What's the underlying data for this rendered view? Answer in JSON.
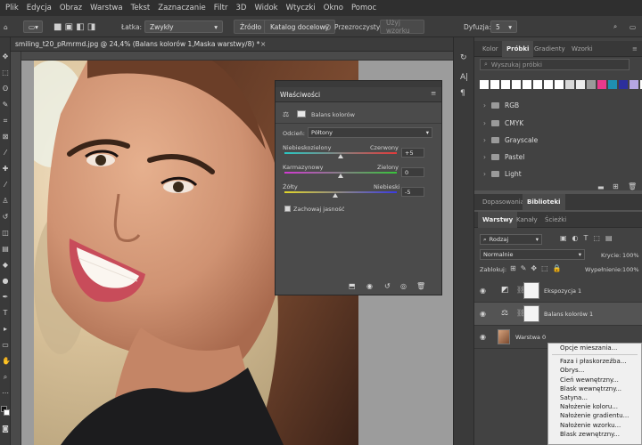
{
  "menu": [
    "Plik",
    "Edycja",
    "Obraz",
    "Warstwa",
    "Tekst",
    "Zaznaczanie",
    "Filtr",
    "3D",
    "Widok",
    "Wtyczki",
    "Okno",
    "Pomoc"
  ],
  "options": {
    "latka_label": "Łatka:",
    "latka_value": "Zwykły",
    "zrodlo": "Źródło",
    "katalog": "Katalog docelowy",
    "przezroczysty": "Przezroczysty",
    "uzyj_wzorku": "Użyj wzorku",
    "dyfuzja_label": "Dyfuzja:",
    "dyfuzja_value": "5"
  },
  "document": {
    "tab_title": "smiling_t20_pRmrmd.jpg @ 24,4% (Balans kolorów 1,Maska warstwy/8) *",
    "close": "×"
  },
  "properties": {
    "title": "Właściwości",
    "adjustment": "Balans kolorów",
    "tone_label": "Odcień:",
    "tone_value": "Półtony",
    "slider1_left": "Niebieskozielony",
    "slider1_right": "Czerwony",
    "slider1_value": "+5",
    "slider2_left": "Karmazynowy",
    "slider2_right": "Zielony",
    "slider2_value": "0",
    "slider3_left": "Żółty",
    "slider3_right": "Niebieski",
    "slider3_value": "-5",
    "preserve": "Zachowaj jasność"
  },
  "swatches_panel": {
    "tabs": [
      "Kolor",
      "Próbki",
      "Gradienty",
      "Wzorki"
    ],
    "active_tab": "Próbki",
    "search_placeholder": "Wyszukaj próbki",
    "swatch_colors": [
      "#ffffff",
      "#ffffff",
      "#ffffff",
      "#ffffff",
      "#ffffff",
      "#ffffff",
      "#ffffff",
      "#ffffff",
      "#d8d8d8",
      "#ececec",
      "#9a9a9a",
      "#e83a8c",
      "#1f8fb0",
      "#2c2f9c",
      "#b6a6e4",
      "#ffffff"
    ],
    "folders": [
      "RGB",
      "CMYK",
      "Grayscale",
      "Pastel",
      "Light"
    ]
  },
  "adjust_tabs": [
    "Dopasowania",
    "Biblioteki"
  ],
  "layers_panel": {
    "tabs": [
      "Warstwy",
      "Kanały",
      "Ścieżki"
    ],
    "filter_kind": "Rodzaj",
    "blend_mode": "Normalnie",
    "opacity_label": "Krycie:",
    "opacity_value": "100%",
    "lock_label": "Zablokuj:",
    "fill_label": "Wypełnienie:",
    "fill_value": "100%",
    "layers": [
      {
        "name": "Ekspozycja 1"
      },
      {
        "name": "Balans kolorów 1"
      },
      {
        "name": "Warstwa 0"
      }
    ]
  },
  "context_menu": [
    "Opcje mieszania...",
    "Faza i płaskorzeźba...",
    "Obrys...",
    "Cień wewnętrzny...",
    "Blask wewnętrzny...",
    "Satyna...",
    "Nałożenie koloru...",
    "Nałożenie gradientu...",
    "Nałożenie wzorku...",
    "Blask zewnętrzny..."
  ]
}
